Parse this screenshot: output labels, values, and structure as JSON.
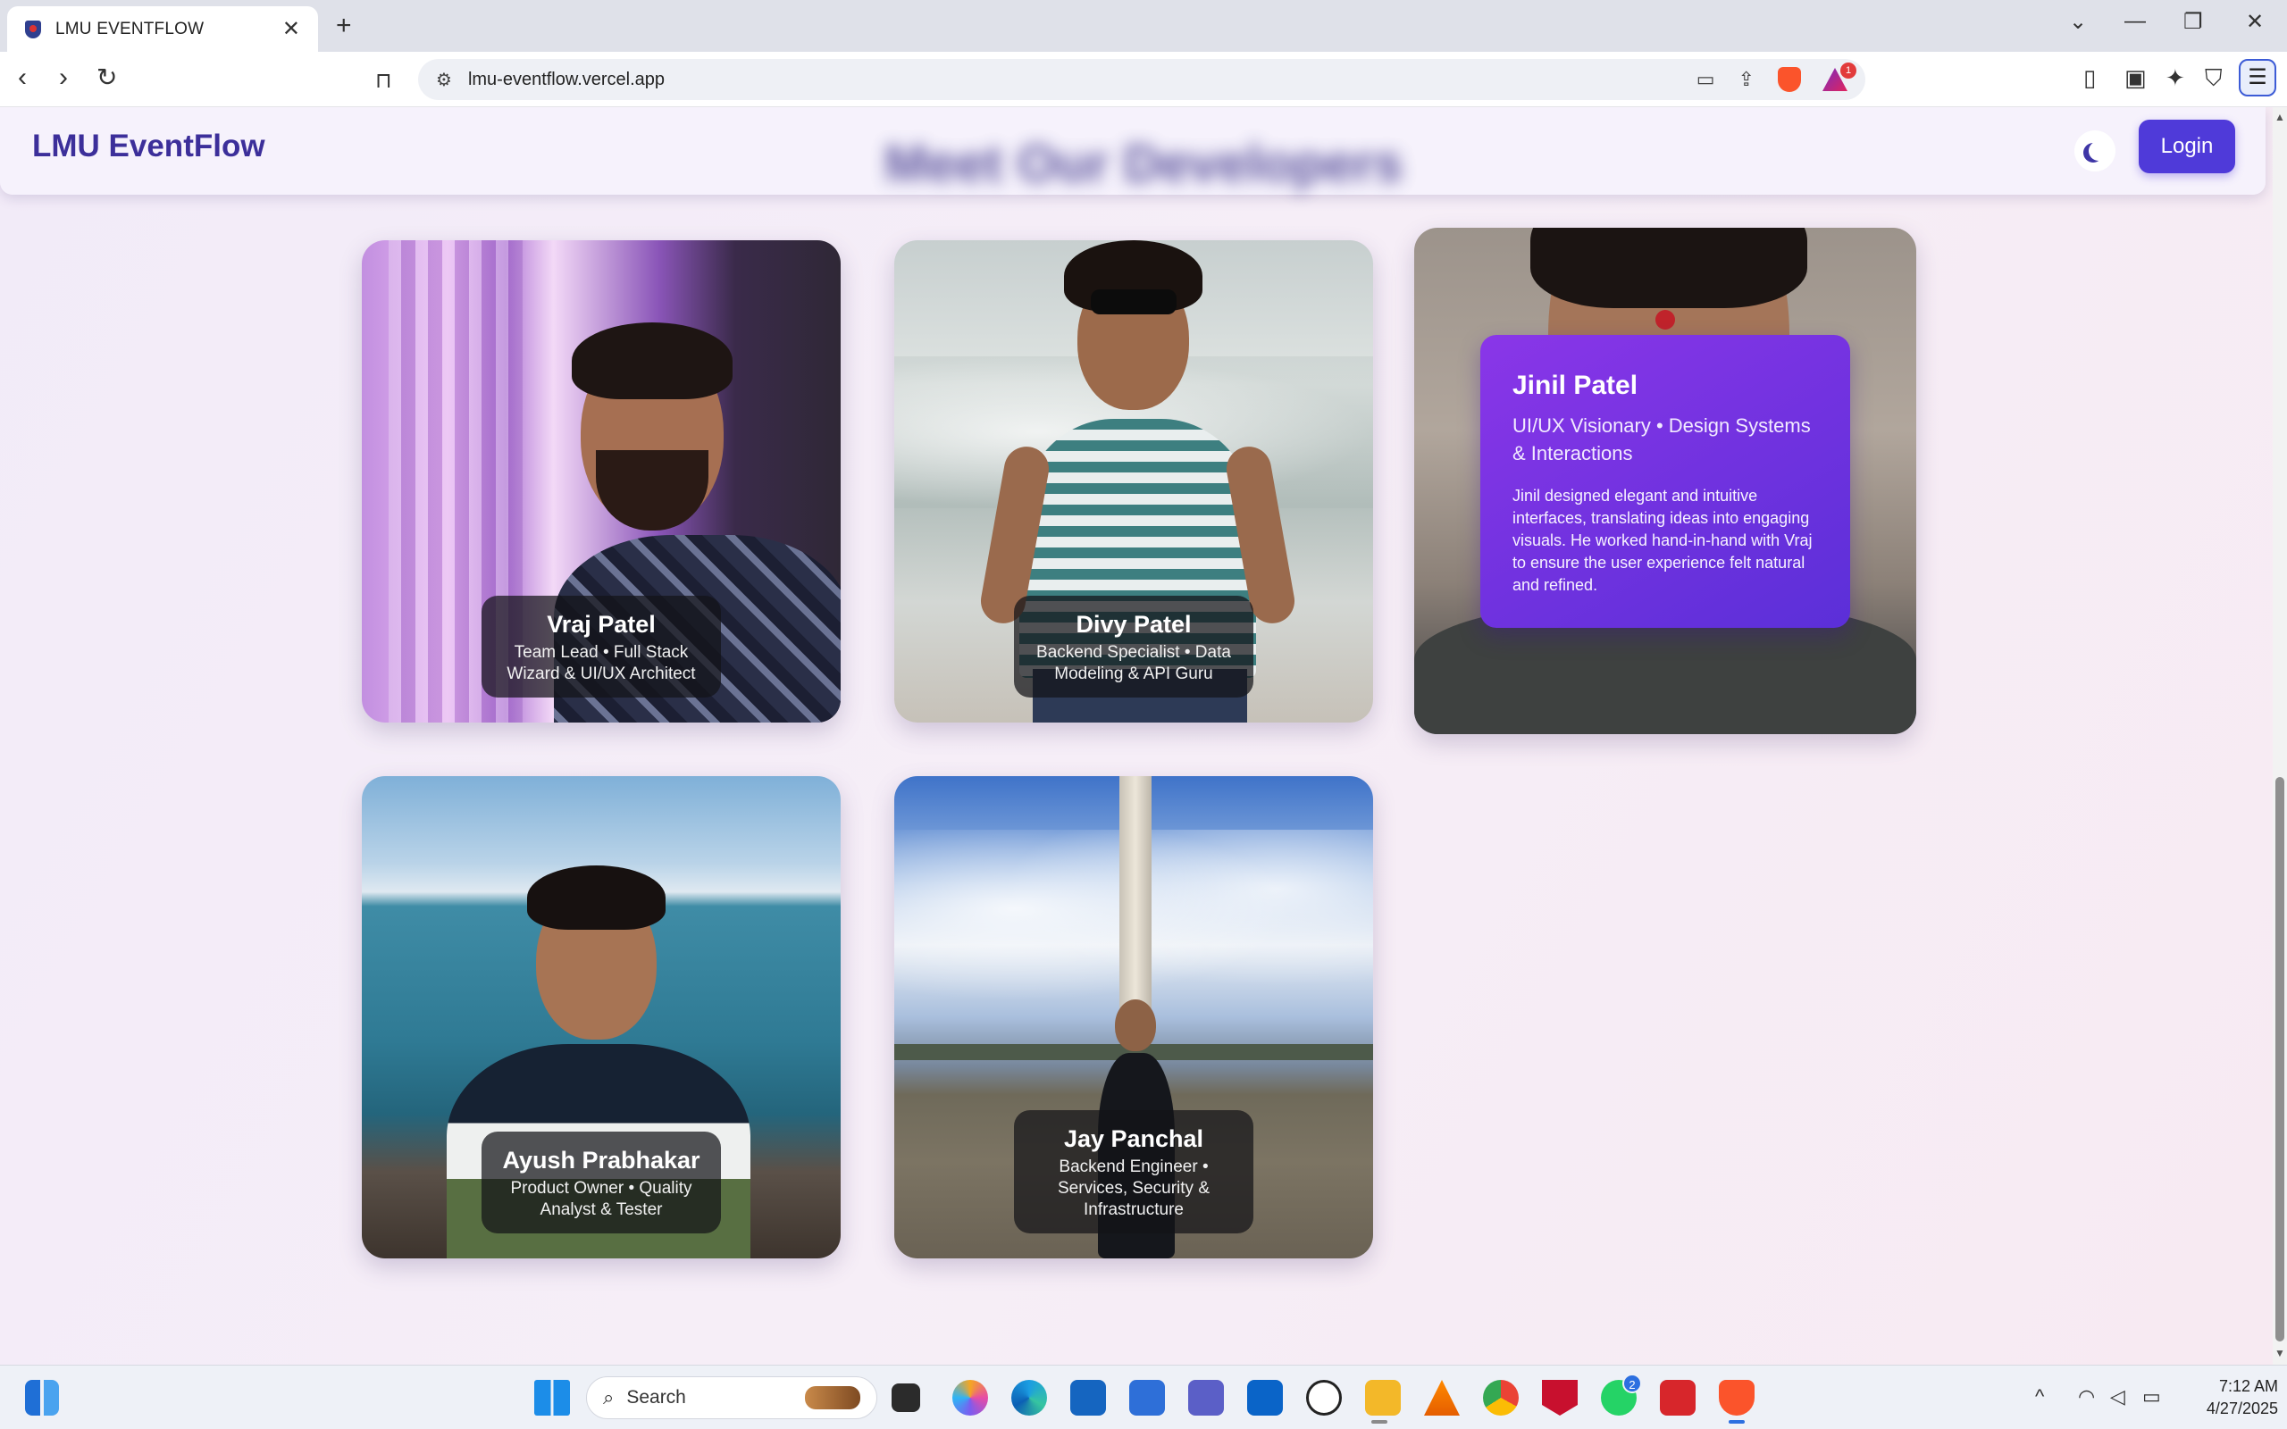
{
  "browser": {
    "tab_title": "LMU EVENTFLOW",
    "url": "lmu-eventflow.vercel.app",
    "rewards_badge": "1"
  },
  "nav": {
    "brand": "LMU EventFlow",
    "blurred_heading": "Meet Our Developers",
    "login_label": "Login"
  },
  "team": [
    {
      "name": "Vraj Patel",
      "role_line1": "Team Lead • Full Stack",
      "role_line2": "Wizard & UI/UX Architect"
    },
    {
      "name": "Divy Patel",
      "role_line1": "Backend Specialist • Data",
      "role_line2": "Modeling & API Guru"
    },
    {
      "name": "Jinil Patel",
      "role_line1": "UI/UX Visionary • Design Systems",
      "role_line2": "& Interactions",
      "description": "Jinil designed elegant and intuitive interfaces, translating ideas into engaging visuals. He worked hand-in-hand with Vraj to ensure the user experience felt natural and refined."
    },
    {
      "name": "Ayush Prabhakar",
      "role_line1": "Product Owner • Quality",
      "role_line2": "Analyst & Tester"
    },
    {
      "name": "Jay Panchal",
      "role_line1": "Backend Engineer •",
      "role_line2": "Services, Security &",
      "role_line3": "Infrastructure"
    }
  ],
  "taskbar": {
    "search_placeholder": "Search",
    "whatsapp_badge": "2",
    "time": "7:12 AM",
    "date": "4/27/2025"
  }
}
